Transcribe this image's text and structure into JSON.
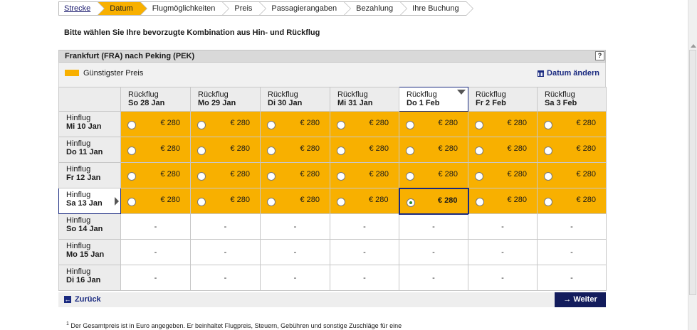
{
  "steps": [
    {
      "label": "Strecke"
    },
    {
      "label": "Datum"
    },
    {
      "label": "Flugmöglichkeiten"
    },
    {
      "label": "Preis"
    },
    {
      "label": "Passagierangaben"
    },
    {
      "label": "Bezahlung"
    },
    {
      "label": "Ihre Buchung"
    }
  ],
  "instruction": "Bitte wählen Sie Ihre bevorzugte Kombination aus Hin- und Rückflug",
  "route": "Frankfurt (FRA) nach Peking (PEK)",
  "help_label": "?",
  "legend": {
    "label": "Günstigster Preis",
    "color": "#f8b000"
  },
  "change_date": "Datum ändern",
  "return_label": "Rückflug",
  "outbound_label": "Hinflug",
  "return_dates": [
    "So 28 Jan",
    "Mo 29 Jan",
    "Di 30 Jan",
    "Mi 31 Jan",
    "Do 1 Feb",
    "Fr 2 Feb",
    "Sa 3 Feb"
  ],
  "outbound_dates": [
    "Mi 10 Jan",
    "Do 11 Jan",
    "Fr 12 Jan",
    "Sa 13 Jan",
    "So 14 Jan",
    "Mo 15 Jan",
    "Di 16 Jan"
  ],
  "prices": [
    [
      "€ 280",
      "€ 280",
      "€ 280",
      "€ 280",
      "€ 280",
      "€ 280",
      "€ 280"
    ],
    [
      "€ 280",
      "€ 280",
      "€ 280",
      "€ 280",
      "€ 280",
      "€ 280",
      "€ 280"
    ],
    [
      "€ 280",
      "€ 280",
      "€ 280",
      "€ 280",
      "€ 280",
      "€ 280",
      "€ 280"
    ],
    [
      "€ 280",
      "€ 280",
      "€ 280",
      "€ 280",
      "€ 280",
      "€ 280",
      "€ 280"
    ],
    [
      "-",
      "-",
      "-",
      "-",
      "-",
      "-",
      "-"
    ],
    [
      "-",
      "-",
      "-",
      "-",
      "-",
      "-",
      "-"
    ],
    [
      "-",
      "-",
      "-",
      "-",
      "-",
      "-",
      "-"
    ]
  ],
  "selected": {
    "outbound": "Sa 13 Jan",
    "return": "Do 1 Feb"
  },
  "nav": {
    "back": "Zurück",
    "next": "Weiter"
  },
  "footnote": {
    "mark": "1",
    "text": "Der Gesamtpreis ist in Euro angegeben. Er beinhaltet Flugpreis, Steuern, Gebühren und sonstige Zuschläge für eine"
  }
}
